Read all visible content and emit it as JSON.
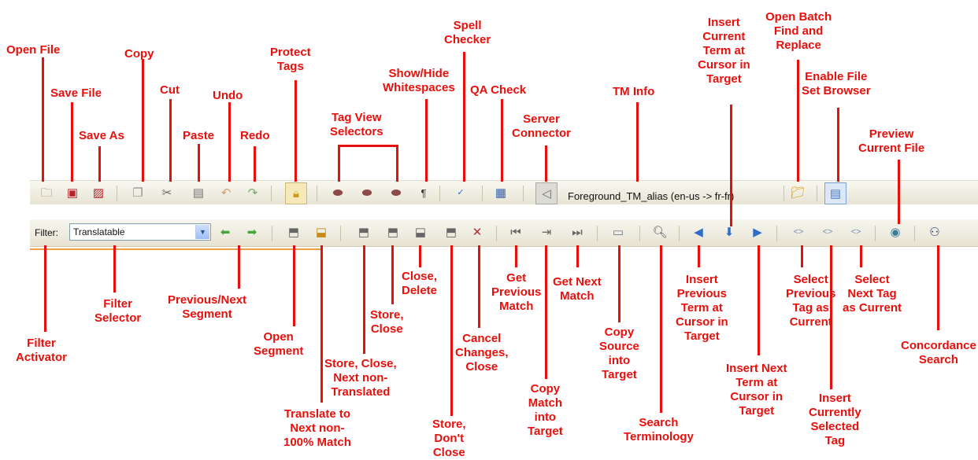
{
  "toolbar1": {
    "tm_alias": "Foreground_TM_alias (en-us -> fr-fr)",
    "icons": [
      "folder-icon",
      "save-icon",
      "save-as-icon",
      "copy-icon",
      "cut-icon",
      "paste-icon",
      "undo-icon",
      "redo-icon",
      "lock-icon",
      "tag-view-full-icon",
      "tag-view-partial-icon",
      "tag-view-none-icon",
      "pilcrow-icon",
      "spell-check-icon",
      "qa-check-icon",
      "server-connector-icon",
      "batch-find-replace-icon",
      "file-set-browser-icon"
    ]
  },
  "toolbar2": {
    "filter_label": "Filter:",
    "filter_value": "Translatable"
  },
  "callouts": {
    "open_file": "Open File",
    "save_file": "Save File",
    "save_as": "Save As",
    "copy": "Copy",
    "cut": "Cut",
    "paste": "Paste",
    "undo": "Undo",
    "redo": "Redo",
    "protect_tags": "Protect\nTags",
    "tag_view": "Tag View\nSelectors",
    "show_hide": "Show/Hide\nWhitespaces",
    "spell": "Spell\nChecker",
    "qa": "QA Check",
    "server": "Server\nConnector",
    "tm_info": "TM Info",
    "insert_current_term": "Insert\nCurrent\nTerm at\nCursor in\nTarget",
    "batch_find": "Open Batch\nFind and\nReplace",
    "file_set": "Enable File\nSet Browser",
    "preview": "Preview\nCurrent File",
    "filter_activator": "Filter\nActivator",
    "filter_selector": "Filter\nSelector",
    "prev_next_segment": "Previous/Next\nSegment",
    "open_segment": "Open\nSegment",
    "translate_next": "Translate to\nNext non-\n100% Match",
    "store_close_next": "Store, Close,\nNext non-\nTranslated",
    "store_close": "Store,\nClose",
    "close_delete": "Close,\nDelete",
    "store_dont_close": "Store,\nDon't\nClose",
    "cancel_changes": "Cancel\nChanges,\nClose",
    "get_prev_match": "Get\nPrevious\nMatch",
    "copy_match": "Copy\nMatch\ninto\nTarget",
    "get_next_match": "Get Next\nMatch",
    "copy_source": "Copy\nSource\ninto\nTarget",
    "search_terminology": "Search\nTerminology",
    "insert_prev_term": "Insert\nPrevious\nTerm at\nCursor in\nTarget",
    "insert_next_term": "Insert Next\nTerm at\nCursor in\nTarget",
    "select_prev_tag": "Select\nPrevious\nTag as\nCurrent",
    "insert_selected_tag": "Insert\nCurrently\nSelected\nTag",
    "select_next_tag": "Select\nNext Tag\nas Current",
    "concordance": "Concordance\nSearch"
  }
}
